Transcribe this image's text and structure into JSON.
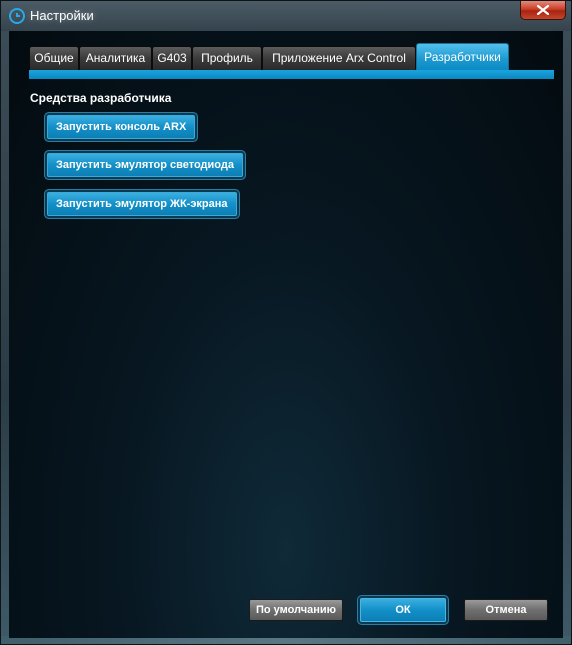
{
  "window": {
    "title": "Настройки",
    "accent_color": "#0a8fc9",
    "icons": {
      "logo": "logitech-g-icon",
      "close": "close-icon"
    }
  },
  "tabs": [
    {
      "label": "Общие",
      "active": false
    },
    {
      "label": "Аналитика",
      "active": false
    },
    {
      "label": "G403",
      "active": false
    },
    {
      "label": "Профиль",
      "active": false
    },
    {
      "label": "Приложение Arx Control",
      "active": false
    },
    {
      "label": "Разработчики",
      "active": true
    }
  ],
  "developer": {
    "section_title": "Средства разработчика",
    "buttons": {
      "arx_console": "Запустить консоль ARX",
      "led_emulator": "Запустить эмулятор светодиода",
      "lcd_emulator": "Запустить эмулятор ЖК-экрана"
    }
  },
  "footer": {
    "defaults_label": "По умолчанию",
    "ok_label": "ОК",
    "cancel_label": "Отмена"
  }
}
